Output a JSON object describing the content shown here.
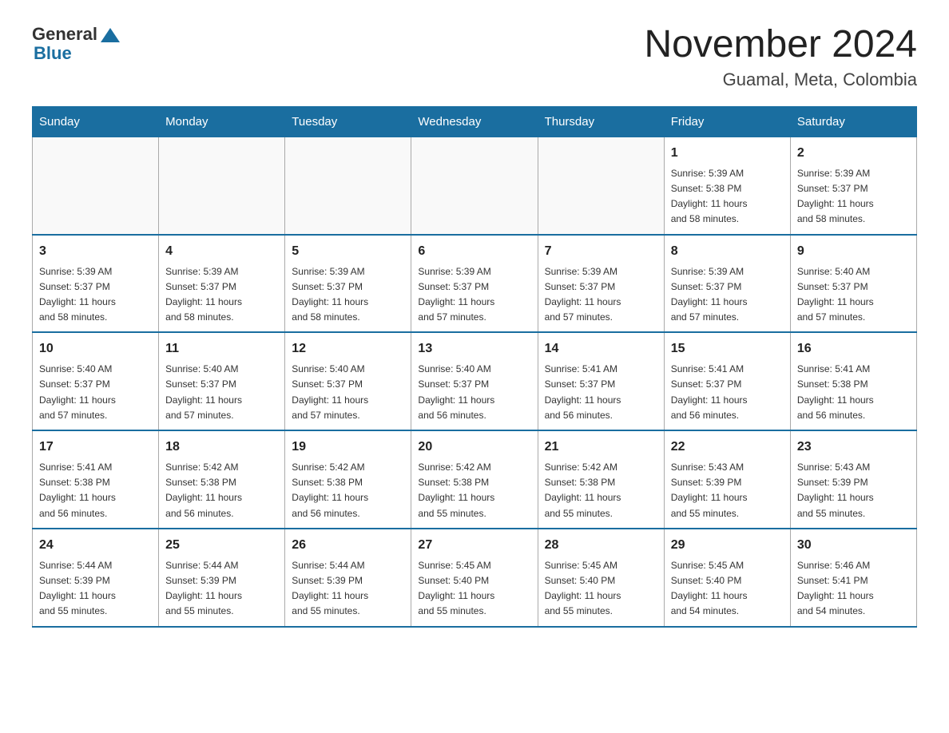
{
  "logo": {
    "general": "General",
    "blue": "Blue"
  },
  "title": "November 2024",
  "subtitle": "Guamal, Meta, Colombia",
  "days_of_week": [
    "Sunday",
    "Monday",
    "Tuesday",
    "Wednesday",
    "Thursday",
    "Friday",
    "Saturday"
  ],
  "weeks": [
    [
      {
        "day": "",
        "info": ""
      },
      {
        "day": "",
        "info": ""
      },
      {
        "day": "",
        "info": ""
      },
      {
        "day": "",
        "info": ""
      },
      {
        "day": "",
        "info": ""
      },
      {
        "day": "1",
        "info": "Sunrise: 5:39 AM\nSunset: 5:38 PM\nDaylight: 11 hours\nand 58 minutes."
      },
      {
        "day": "2",
        "info": "Sunrise: 5:39 AM\nSunset: 5:37 PM\nDaylight: 11 hours\nand 58 minutes."
      }
    ],
    [
      {
        "day": "3",
        "info": "Sunrise: 5:39 AM\nSunset: 5:37 PM\nDaylight: 11 hours\nand 58 minutes."
      },
      {
        "day": "4",
        "info": "Sunrise: 5:39 AM\nSunset: 5:37 PM\nDaylight: 11 hours\nand 58 minutes."
      },
      {
        "day": "5",
        "info": "Sunrise: 5:39 AM\nSunset: 5:37 PM\nDaylight: 11 hours\nand 58 minutes."
      },
      {
        "day": "6",
        "info": "Sunrise: 5:39 AM\nSunset: 5:37 PM\nDaylight: 11 hours\nand 57 minutes."
      },
      {
        "day": "7",
        "info": "Sunrise: 5:39 AM\nSunset: 5:37 PM\nDaylight: 11 hours\nand 57 minutes."
      },
      {
        "day": "8",
        "info": "Sunrise: 5:39 AM\nSunset: 5:37 PM\nDaylight: 11 hours\nand 57 minutes."
      },
      {
        "day": "9",
        "info": "Sunrise: 5:40 AM\nSunset: 5:37 PM\nDaylight: 11 hours\nand 57 minutes."
      }
    ],
    [
      {
        "day": "10",
        "info": "Sunrise: 5:40 AM\nSunset: 5:37 PM\nDaylight: 11 hours\nand 57 minutes."
      },
      {
        "day": "11",
        "info": "Sunrise: 5:40 AM\nSunset: 5:37 PM\nDaylight: 11 hours\nand 57 minutes."
      },
      {
        "day": "12",
        "info": "Sunrise: 5:40 AM\nSunset: 5:37 PM\nDaylight: 11 hours\nand 57 minutes."
      },
      {
        "day": "13",
        "info": "Sunrise: 5:40 AM\nSunset: 5:37 PM\nDaylight: 11 hours\nand 56 minutes."
      },
      {
        "day": "14",
        "info": "Sunrise: 5:41 AM\nSunset: 5:37 PM\nDaylight: 11 hours\nand 56 minutes."
      },
      {
        "day": "15",
        "info": "Sunrise: 5:41 AM\nSunset: 5:37 PM\nDaylight: 11 hours\nand 56 minutes."
      },
      {
        "day": "16",
        "info": "Sunrise: 5:41 AM\nSunset: 5:38 PM\nDaylight: 11 hours\nand 56 minutes."
      }
    ],
    [
      {
        "day": "17",
        "info": "Sunrise: 5:41 AM\nSunset: 5:38 PM\nDaylight: 11 hours\nand 56 minutes."
      },
      {
        "day": "18",
        "info": "Sunrise: 5:42 AM\nSunset: 5:38 PM\nDaylight: 11 hours\nand 56 minutes."
      },
      {
        "day": "19",
        "info": "Sunrise: 5:42 AM\nSunset: 5:38 PM\nDaylight: 11 hours\nand 56 minutes."
      },
      {
        "day": "20",
        "info": "Sunrise: 5:42 AM\nSunset: 5:38 PM\nDaylight: 11 hours\nand 55 minutes."
      },
      {
        "day": "21",
        "info": "Sunrise: 5:42 AM\nSunset: 5:38 PM\nDaylight: 11 hours\nand 55 minutes."
      },
      {
        "day": "22",
        "info": "Sunrise: 5:43 AM\nSunset: 5:39 PM\nDaylight: 11 hours\nand 55 minutes."
      },
      {
        "day": "23",
        "info": "Sunrise: 5:43 AM\nSunset: 5:39 PM\nDaylight: 11 hours\nand 55 minutes."
      }
    ],
    [
      {
        "day": "24",
        "info": "Sunrise: 5:44 AM\nSunset: 5:39 PM\nDaylight: 11 hours\nand 55 minutes."
      },
      {
        "day": "25",
        "info": "Sunrise: 5:44 AM\nSunset: 5:39 PM\nDaylight: 11 hours\nand 55 minutes."
      },
      {
        "day": "26",
        "info": "Sunrise: 5:44 AM\nSunset: 5:39 PM\nDaylight: 11 hours\nand 55 minutes."
      },
      {
        "day": "27",
        "info": "Sunrise: 5:45 AM\nSunset: 5:40 PM\nDaylight: 11 hours\nand 55 minutes."
      },
      {
        "day": "28",
        "info": "Sunrise: 5:45 AM\nSunset: 5:40 PM\nDaylight: 11 hours\nand 55 minutes."
      },
      {
        "day": "29",
        "info": "Sunrise: 5:45 AM\nSunset: 5:40 PM\nDaylight: 11 hours\nand 54 minutes."
      },
      {
        "day": "30",
        "info": "Sunrise: 5:46 AM\nSunset: 5:41 PM\nDaylight: 11 hours\nand 54 minutes."
      }
    ]
  ]
}
